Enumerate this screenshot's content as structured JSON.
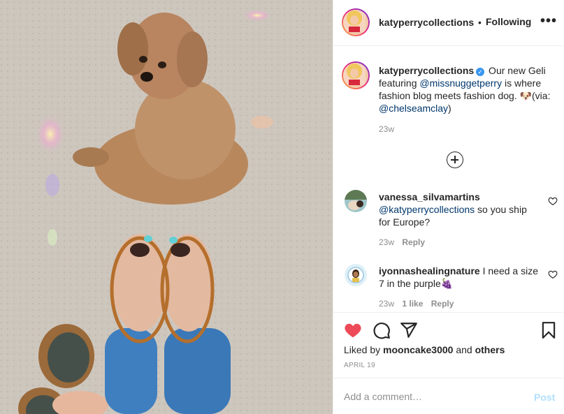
{
  "post": {
    "username": "katyperrycollections",
    "follow_separator": "•",
    "follow_status": "Following",
    "more_label": "•••",
    "caption_username": "katyperrycollections",
    "verified_icon": "verified-badge-icon",
    "caption_part1": " Our new Geli featuring ",
    "caption_mention1": "@missnuggetperry",
    "caption_part2": " is where fashion blog meets fashion dog. 🐶(via: ",
    "caption_mention2": "@chelseamclay",
    "caption_part3": ")",
    "caption_time": "23w",
    "load_more_icon": "plus-circle-icon"
  },
  "comments": [
    {
      "username": "vanessa_silvamartins",
      "mention": "@katyperrycollections",
      "text": " so you ship for Europe?",
      "time": "23w",
      "likes": "",
      "reply": "Reply"
    },
    {
      "username": "iyonnashealingnature",
      "mention": "",
      "text": " I need a size 7 in the purple🍇",
      "time": "23w",
      "likes": "1 like",
      "reply": "Reply"
    }
  ],
  "actions": {
    "like_icon": "heart-filled-icon",
    "comment_icon": "comment-icon",
    "share_icon": "share-icon",
    "save_icon": "bookmark-icon",
    "liked_by_prefix": "Liked by ",
    "liked_by_user": "mooncake3000",
    "liked_by_mid": " and ",
    "liked_by_others": "others",
    "date": "APRIL 19"
  },
  "comment_box": {
    "placeholder": "Add a comment…",
    "post_label": "Post"
  },
  "colors": {
    "like": "#ed4956",
    "mention": "#00376b",
    "verified": "#3897f0",
    "post_button_disabled": "#b2dffc",
    "meta_gray": "#8e8e8e"
  }
}
